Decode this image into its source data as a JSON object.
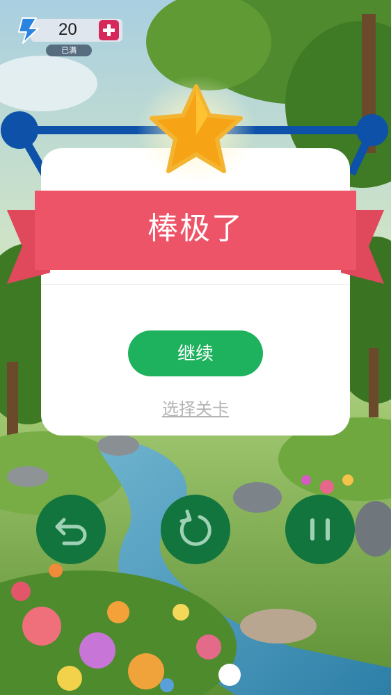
{
  "energy": {
    "count": "20",
    "status": "已满",
    "icons": {
      "bolt": "lightning-bolt-icon",
      "add": "plus-icon"
    }
  },
  "result_dialog": {
    "icon": "star-icon",
    "title": "棒极了",
    "primary_button": "继续",
    "secondary_link": "选择关卡"
  },
  "controls": [
    {
      "icon": "undo-icon"
    },
    {
      "icon": "restart-icon"
    },
    {
      "icon": "pause-icon"
    }
  ],
  "colors": {
    "ribbon": "#ee5468",
    "continue": "#1fb25e",
    "controls": "#13753e",
    "plus": "#d6285a",
    "node": "#0d52a8"
  }
}
